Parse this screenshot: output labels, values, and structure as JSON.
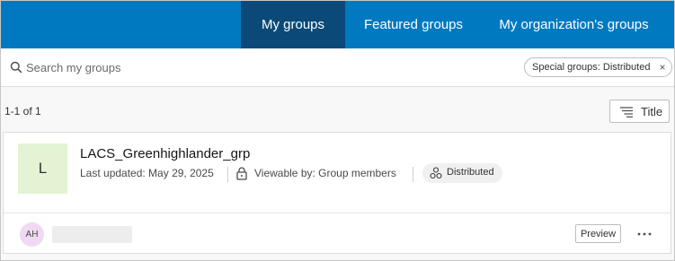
{
  "tabs": [
    {
      "label": "My groups",
      "active": true
    },
    {
      "label": "Featured groups",
      "active": false
    },
    {
      "label": "My organization's groups",
      "active": false
    }
  ],
  "search": {
    "placeholder": "Search my groups",
    "value": "",
    "filter_chip": "Special groups: Distributed",
    "chip_close": "×"
  },
  "results": {
    "count": "1-1 of 1",
    "sort_label": "Title"
  },
  "group": {
    "thumbnail_letter": "L",
    "title": "LACS_Greenhighlander_grp",
    "last_updated": "Last updated: May 29, 2025",
    "viewable_by": "Viewable by: Group members",
    "badge": "Distributed",
    "owner_initials": "AH",
    "preview_label": "Preview",
    "more_label": "…"
  },
  "colors": {
    "tab_bar": "#0079c1",
    "tab_active": "#0b4a78",
    "thumbnail_bg": "#e3f3d4",
    "avatar_bg": "#f0d9f2"
  },
  "icons": [
    "search-icon",
    "close-icon",
    "sort-icon",
    "lock-icon",
    "distributed-icon",
    "more-icon"
  ]
}
